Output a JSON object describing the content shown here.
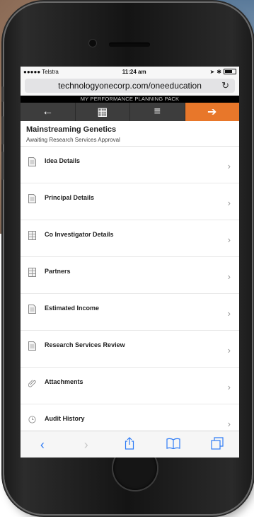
{
  "status_bar": {
    "carrier": "●●●●● Telstra",
    "time": "11:24 am",
    "wifi_icon": "wifi-icon",
    "battery_icon": "battery-icon"
  },
  "browser": {
    "url": "technologyonecorp.com/oneeducation",
    "reload_icon": "reload-icon"
  },
  "banner": "MY PERFORMANCE PLANNING PACK",
  "navbar": {
    "back_glyph": "←",
    "grid_glyph": "▦",
    "menu_glyph": "≡",
    "exit_glyph": "➔",
    "accent_color": "#e8772a"
  },
  "header": {
    "title": "Mainstreaming Genetics",
    "subtitle": "Awaiting Research Services Approval"
  },
  "items": [
    {
      "label": "Idea Details",
      "icon": "document-icon"
    },
    {
      "label": "Principal Details",
      "icon": "document-icon"
    },
    {
      "label": "Co Investigator Details",
      "icon": "grid-form-icon"
    },
    {
      "label": "Partners",
      "icon": "grid-form-icon"
    },
    {
      "label": "Estimated Income",
      "icon": "document-icon"
    },
    {
      "label": "Research Services Review",
      "icon": "document-icon"
    },
    {
      "label": "Attachments",
      "icon": "paperclip-icon"
    },
    {
      "label": "Audit History",
      "icon": "clock-icon"
    }
  ],
  "safari_toolbar": {
    "back": "‹",
    "forward": "›",
    "share_icon": "share-icon",
    "bookmarks_icon": "book-icon",
    "tabs_icon": "tabs-icon"
  }
}
